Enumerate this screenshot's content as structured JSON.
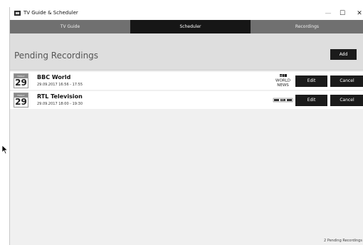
{
  "window": {
    "title": "TV Guide & Scheduler",
    "minimize": "—",
    "maximize": "☐",
    "close": "✕"
  },
  "tabs": [
    {
      "label": "TV Guide",
      "active": false
    },
    {
      "label": "Scheduler",
      "active": true
    },
    {
      "label": "Recordings",
      "active": false
    }
  ],
  "header": {
    "title": "Pending Recordings",
    "add_label": "Add"
  },
  "recordings": [
    {
      "day": "29",
      "month": "FRIDAY",
      "channel": "BBC World",
      "time": "29.09.2017 16:56 - 17:55",
      "logo": "bbc-world-news-logo",
      "logo_text": [
        "BBC",
        "WORLD",
        "NEWS"
      ],
      "edit_label": "Edit",
      "cancel_label": "Cancel"
    },
    {
      "day": "29",
      "month": "FRIDAY",
      "channel": "RTL Television",
      "time": "29.09.2017 18:00 - 19:30",
      "logo": "rtl-logo",
      "logo_text": [
        "RTL"
      ],
      "edit_label": "Edit",
      "cancel_label": "Cancel"
    }
  ],
  "status": {
    "text": "2 Pending Recordings"
  },
  "colors": {
    "tab_inactive": "#707070",
    "tab_active": "#161616",
    "button": "#1b1b1b",
    "header_band": "#dedede"
  }
}
